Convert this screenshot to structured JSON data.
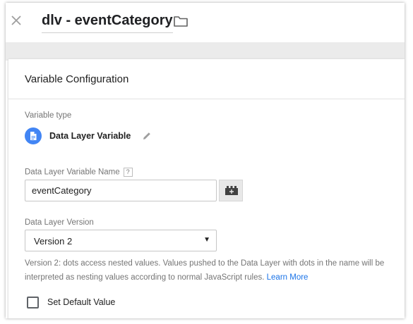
{
  "header": {
    "title": "dlv - eventCategory",
    "close_icon": "close-icon",
    "folder_icon": "folder-icon"
  },
  "card": {
    "title": "Variable Configuration",
    "variable_type": {
      "label": "Variable type",
      "name": "Data Layer Variable",
      "icon": "document-icon",
      "edit_icon": "pencil-icon"
    },
    "variable_name": {
      "label": "Data Layer Variable Name",
      "help": "?",
      "value": "eventCategory",
      "picker_icon": "variable-picker-icon"
    },
    "version": {
      "label": "Data Layer Version",
      "selected": "Version 2",
      "description": "Version 2: dots access nested values. Values pushed to the Data Layer with dots in the name will be interpreted as nesting values according to normal JavaScript rules.",
      "learn_more": "Learn More"
    },
    "default_value": {
      "label": "Set Default Value",
      "checked": false
    }
  },
  "colors": {
    "accent_blue": "#4285f4",
    "link_blue": "#1a73e8",
    "band_grey": "#ebebeb"
  }
}
